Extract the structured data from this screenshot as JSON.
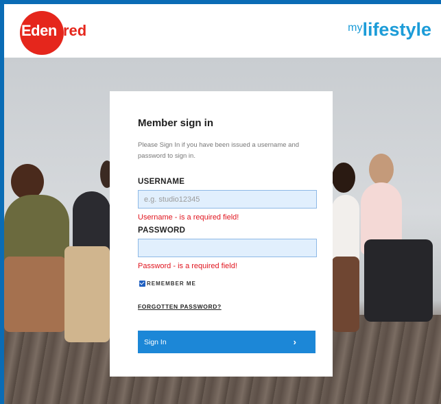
{
  "header": {
    "brand_left_inner": "Eden",
    "brand_left_outer": "red",
    "brand_right_sup": "my",
    "brand_right_main": "lifestyle"
  },
  "form": {
    "title": "Member sign in",
    "description": "Please Sign In if you have been issued a username and password to sign in.",
    "username_label": "USERNAME",
    "username_placeholder": "e.g. studio12345",
    "username_value": "",
    "username_error": "Username - is a required field!",
    "password_label": "PASSWORD",
    "password_value": "",
    "password_error": "Password - is a required field!",
    "remember_label": "REMEMBER ME",
    "remember_checked": true,
    "forgot_label": "FORGOTTEN PASSWORD?",
    "signin_label": "Sign In",
    "signin_chevron": "›"
  },
  "colors": {
    "frame_blue": "#0a6cb5",
    "brand_red": "#e5261c",
    "brand_blue": "#1c9cd8",
    "button_blue": "#1c87d7",
    "error_red": "#e0141e",
    "input_fill": "#e1effd"
  }
}
